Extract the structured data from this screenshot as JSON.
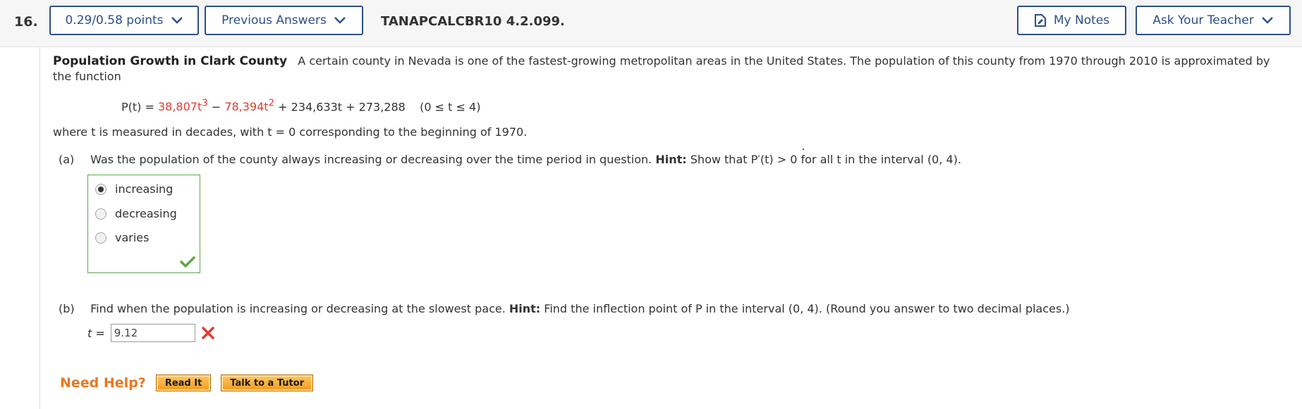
{
  "header": {
    "question_number": "16.",
    "points_label": "0.29/0.58 points",
    "previous_answers_label": "Previous Answers",
    "question_code": "TANAPCALCBR10 4.2.099.",
    "my_notes_label": "My Notes",
    "ask_teacher_label": "Ask Your Teacher"
  },
  "problem": {
    "title": "Population Growth in Clark County",
    "intro_text": "A certain county in Nevada is one of the fastest-growing metropolitan areas in the United States. The population of this county from 1970 through 2010 is approximated by the function",
    "formula_lhs": "P(t) = ",
    "term1_coef": "38,807t",
    "term1_exp": "3",
    "minus": " − ",
    "term2_coef": "78,394t",
    "term2_exp": "2",
    "formula_rest": " + 234,633t + 273,288",
    "domain": "(0 ≤ t ≤ 4)",
    "where_text": "where t is measured in decades, with t = 0 corresponding to the beginning of 1970."
  },
  "part_a": {
    "label": "(a)",
    "question": "Was the population of the county always increasing or decreasing over the time period in question.",
    "hint_label": "Hint:",
    "hint_text": "Show that P′(t) > 0 for all t in the interval (0, 4).",
    "options": [
      "increasing",
      "decreasing",
      "varies"
    ],
    "selected": "increasing",
    "status": "correct",
    "correct_color": "#5aa845"
  },
  "part_b": {
    "label": "(b)",
    "question": "Find when the population is increasing or decreasing at the slowest pace.",
    "hint_label": "Hint:",
    "hint_text": "Find the inflection point of P in the interval (0, 4). (Round you answer to two decimal places.)",
    "answer_prefix": "t =",
    "answer_value": "9.12",
    "status": "incorrect",
    "incorrect_color": "#e03c31"
  },
  "help": {
    "title": "Need Help?",
    "read_it_label": "Read It",
    "talk_tutor_label": "Talk to a Tutor"
  },
  "colors": {
    "accent": "#2b4f8a",
    "help_orange": "#e87722"
  }
}
